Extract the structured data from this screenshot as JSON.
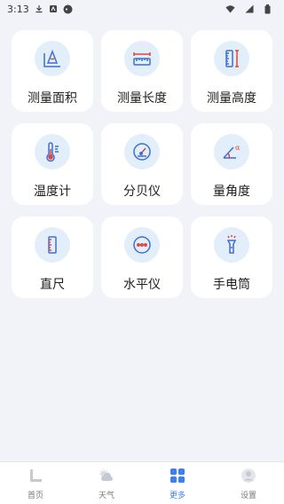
{
  "status_bar": {
    "time": "3:13"
  },
  "tools": [
    {
      "label": "测量面积",
      "icon": "area-measure-icon"
    },
    {
      "label": "测量长度",
      "icon": "length-measure-icon"
    },
    {
      "label": "测量高度",
      "icon": "height-measure-icon"
    },
    {
      "label": "温度计",
      "icon": "thermometer-icon"
    },
    {
      "label": "分贝仪",
      "icon": "decibel-gauge-icon"
    },
    {
      "label": "量角度",
      "icon": "angle-icon"
    },
    {
      "label": "直尺",
      "icon": "ruler-icon"
    },
    {
      "label": "水平仪",
      "icon": "level-icon"
    },
    {
      "label": "手电筒",
      "icon": "flashlight-icon"
    }
  ],
  "nav": [
    {
      "label": "首页",
      "icon": "home-ruler-icon",
      "active": false
    },
    {
      "label": "天气",
      "icon": "weather-icon",
      "active": false
    },
    {
      "label": "更多",
      "icon": "more-grid-icon",
      "active": true
    },
    {
      "label": "设置",
      "icon": "settings-user-icon",
      "active": false
    }
  ],
  "colors": {
    "accent": "#3d7ff3",
    "icon_blue": "#3f6fd0",
    "icon_red": "#e0453a",
    "tile_bg": "#ffffff",
    "circle_bg": "#e3eefb"
  }
}
